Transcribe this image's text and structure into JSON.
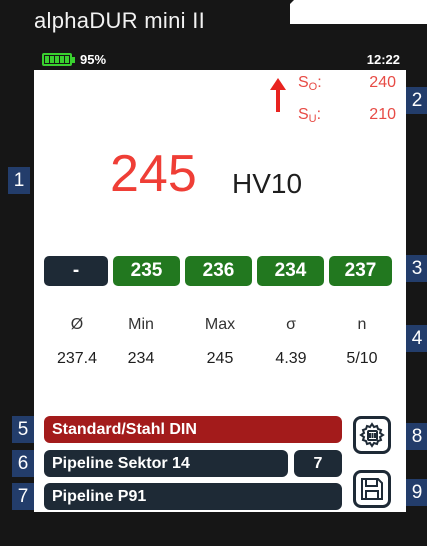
{
  "device": {
    "title": "alphaDUR mini II"
  },
  "status": {
    "battery_percent": "95%",
    "battery_level": 0.95,
    "time": "12:22"
  },
  "limits": {
    "upper_label": "S",
    "upper_sub": "O",
    "upper_suffix": ":",
    "upper_value": "240",
    "lower_label": "S",
    "lower_sub": "U",
    "lower_suffix": ":",
    "lower_value": "210",
    "trend": "up"
  },
  "measurement": {
    "value": "245",
    "unit": "HV10"
  },
  "readings": [
    "-",
    "235",
    "236",
    "234",
    "237"
  ],
  "stats": {
    "headers": [
      "Ø",
      "Min",
      "Max",
      "σ",
      "n"
    ],
    "values": [
      "237.4",
      "234",
      "245",
      "4.39",
      "5/10"
    ]
  },
  "fields": {
    "material": "Standard/Stahl DIN",
    "location": "Pipeline Sektor 14",
    "location_count": "7",
    "object": "Pipeline P91"
  },
  "badges": [
    "1",
    "2",
    "3",
    "4",
    "5",
    "6",
    "7",
    "8",
    "9"
  ],
  "icons": {
    "settings": "gear-sliders-icon",
    "save": "floppy-disk-icon",
    "arrow": "arrow-up-icon"
  },
  "colors": {
    "limit_red": "#e74b45",
    "value_red": "#ef3e36",
    "reading_green": "#22781f",
    "material_red": "#a31b1b",
    "bar_dark": "#1e2a36",
    "badge_blue": "#233d6b",
    "battery_green": "#39d12f"
  }
}
